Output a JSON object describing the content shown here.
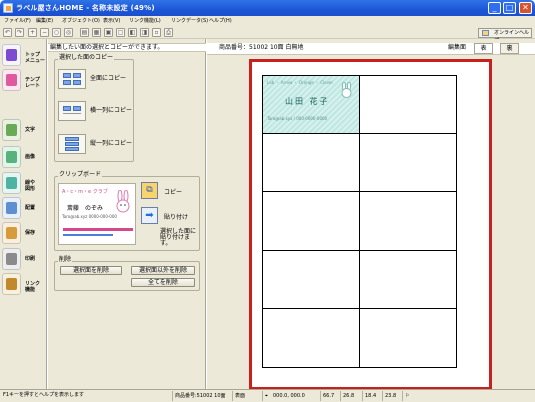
{
  "window": {
    "title": "ラベル屋さんHOME - 名称未設定 (49%)",
    "min": "_",
    "max": "□",
    "close": "✕"
  },
  "menu": [
    "ファイル(F)",
    "編集(E)",
    "オブジェクト(O)",
    "表示(V)",
    "リンク機能(L)",
    "リンクデータ(S)",
    "ヘルプ(H)"
  ],
  "toolbar": {
    "help_label": "オンラインヘルプ"
  },
  "sidebar": [
    {
      "label": "トップ\nメニュー",
      "color": "#f4f4fb",
      "accent": "#7c4bd2"
    },
    {
      "label": "テンプ\nレート",
      "color": "#fbe9f2",
      "accent": "#e05a9f"
    },
    {
      "label": "文字",
      "color": "#e9f1e3",
      "accent": "#6aaa57"
    },
    {
      "label": "画像",
      "color": "#e3f4e9",
      "accent": "#58b27d"
    },
    {
      "label": "線や\n図形",
      "color": "#e6f4f2",
      "accent": "#4fb3a4"
    },
    {
      "label": "配置",
      "color": "#e8f1fa",
      "accent": "#5d8fd1"
    },
    {
      "label": "保存",
      "color": "#f8efe1",
      "accent": "#d89b3b"
    },
    {
      "label": "印刷",
      "color": "#eeeeee",
      "accent": "#8b8b8b"
    },
    {
      "label": "リンク\n機能",
      "color": "#f7f0df",
      "accent": "#c08a2c"
    }
  ],
  "panel": {
    "top_text": "編集したい面の選択とコピーができます。",
    "group1_label": "選択した面のコピー",
    "copy_all": "全面にコピー",
    "copy_row": "横一列にコピー",
    "copy_col": "縦一列にコピー",
    "clipboard_label": "クリップボード",
    "btn_copy": "コピー",
    "btn_paste": "貼り付け",
    "paste_note": "選択した面に貼り付けます。",
    "preview_header": "A・c・m・e クラブ",
    "preview_name": "斎藤　のぞみ",
    "preview_email": "Taro@ab.xyz  0000-000-000",
    "delete_label": "削除",
    "del_selected": "選択面を削除",
    "del_others": "選択面以外を削除",
    "del_all": "全てを削除"
  },
  "workspace": {
    "product_info": "商品番号：51002 10面 白無地",
    "edit_label": "編集面",
    "tab_front": "表",
    "tab_back": "裏",
    "card_header": "Lab ・ Arrow ・ Orange ・ Clover",
    "card_name": "山田 花子",
    "card_small": "Taro@ab.xyz / 000-0000-0000"
  },
  "statusbar": {
    "hint": "F1キーを押すとヘルプを表示します",
    "product": "商品番号:51002 10面",
    "face": "表面",
    "coords": "000.0, 000.0",
    "w": "66.7",
    "h": "26.8",
    "x": "18.4",
    "y": "23.8"
  }
}
